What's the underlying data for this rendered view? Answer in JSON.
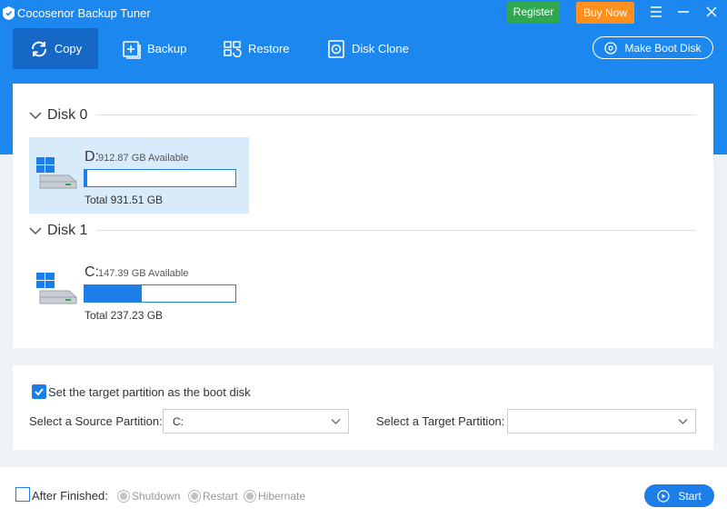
{
  "app": {
    "title": "Cocosenor Backup Tuner",
    "accent_color": "#1d87f0",
    "register_label": "Register",
    "buy_label": "Buy Now",
    "icons": [
      "app-logo-icon",
      "menu-icon",
      "minimize-icon",
      "close-icon"
    ]
  },
  "tabs": [
    {
      "label": "Copy",
      "icon": "copy-icon",
      "active": true
    },
    {
      "label": "Backup",
      "icon": "backup-icon",
      "active": false
    },
    {
      "label": "Restore",
      "icon": "restore-icon",
      "active": false
    },
    {
      "label": "Disk Clone",
      "icon": "disk-clone-icon",
      "active": false
    }
  ],
  "boot_button_label": "Make Boot Disk",
  "disks": [
    {
      "name": "Disk 0",
      "partition": {
        "letter": "D:",
        "available": "912.87 GB Available",
        "total": "Total 931.51 GB",
        "used_fraction": 0.02,
        "selected": true
      }
    },
    {
      "name": "Disk 1",
      "partition": {
        "letter": "C:",
        "available": "147.39 GB Available",
        "total": "Total 237.23 GB",
        "used_fraction": 0.38,
        "selected": false
      }
    }
  ],
  "options": {
    "boot_checkbox_label": "Set the target partition as the boot disk",
    "boot_checked": true,
    "source_label": "Select a Source Partition:",
    "source_value": "C:",
    "target_label": "Select a Target Partition:",
    "target_value": ""
  },
  "footer": {
    "after_label": "After Finished:",
    "after_checked": false,
    "radios": [
      "Shutdown",
      "Restart",
      "Hibernate"
    ],
    "start_label": "Start"
  }
}
